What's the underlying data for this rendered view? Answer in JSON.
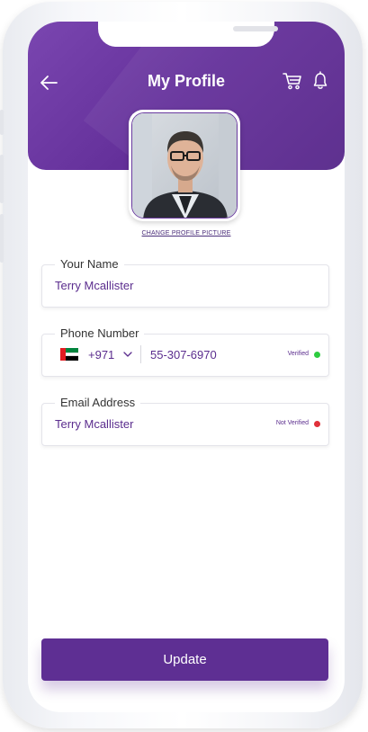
{
  "header": {
    "title": "My Profile",
    "back_icon": "arrow-left-icon",
    "cart_icon": "cart-icon",
    "bell_icon": "bell-icon"
  },
  "profile": {
    "change_picture_label": "CHANGE PROFILE PICTURE"
  },
  "fields": {
    "name": {
      "label": "Your Name",
      "value": "Terry Mcallister"
    },
    "phone": {
      "label": "Phone Number",
      "country_code": "+971",
      "value": "55-307-6970",
      "status": "Verified",
      "status_color": "#2ecc40"
    },
    "email": {
      "label": "Email Address",
      "value": "Terry Mcallister",
      "status": "Not Verified",
      "status_color": "#e0313a"
    }
  },
  "actions": {
    "update_label": "Update"
  },
  "colors": {
    "brand": "#5e2f93",
    "text_accent": "#5b2d8e"
  }
}
